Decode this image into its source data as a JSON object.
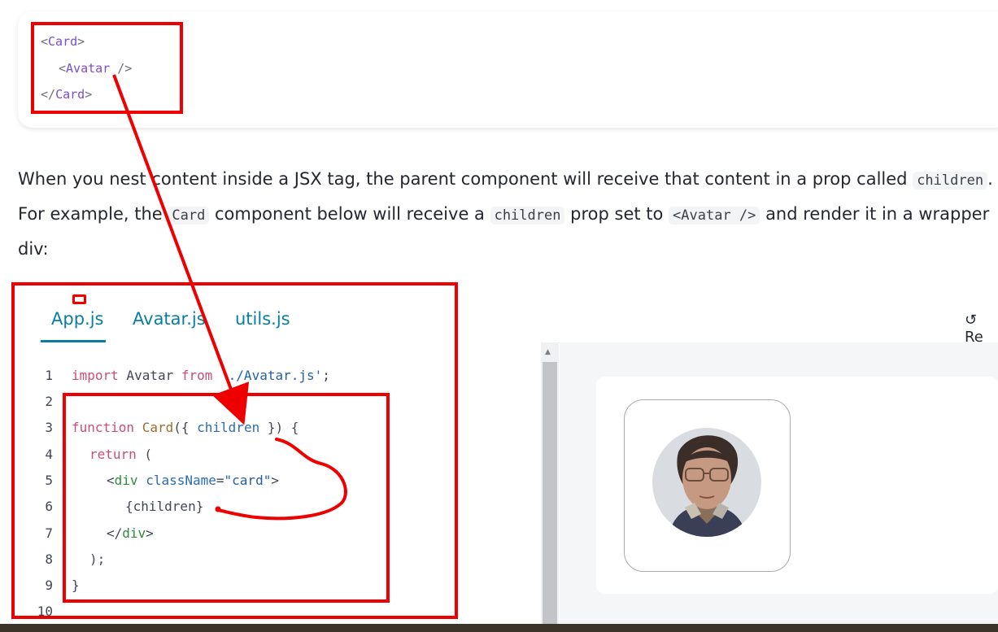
{
  "snippet": {
    "line1_open": "<",
    "line1_tag": "Card",
    "line1_close": ">",
    "line2_open": "<",
    "line2_tag": "Avatar",
    "line2_close": " />",
    "line3_open": "</",
    "line3_tag": "Card",
    "line3_close": ">"
  },
  "paragraph": {
    "t1": "When you nest content inside a JSX tag, the parent component will receive that content in a prop called ",
    "c1": "children",
    "t2": ". For example, the ",
    "c2": "Card",
    "t3": " component below will receive a ",
    "c3": "children",
    "t4": " prop set to ",
    "c4": "<Avatar />",
    "t5": " and render it in a wrapper div:"
  },
  "sandpack": {
    "tabs": [
      {
        "label": "App.js",
        "active": true
      },
      {
        "label": "Avatar.js",
        "active": false
      },
      {
        "label": "utils.js",
        "active": false
      }
    ],
    "reset_label": "Re",
    "reset_icon": "reset-icon",
    "line_numbers": [
      "1",
      "2",
      "3",
      "4",
      "5",
      "6",
      "7",
      "8",
      "9",
      "10"
    ],
    "code": {
      "l1": {
        "kw": "import",
        "t1": " Avatar ",
        "kw2": "from",
        "t2": " ",
        "str": "'./Avatar.js'",
        "t3": ";"
      },
      "l3": {
        "kw": "function",
        "t1": " ",
        "fn": "Card",
        "t2": "({ ",
        "pr": "children",
        "t3": " }) {"
      },
      "l4": {
        "kw": "return",
        "t1": " ("
      },
      "l5": {
        "t1": "<",
        "jt": "div",
        "t2": " ",
        "at": "className",
        "t3": "=",
        "str": "\"card\"",
        "t4": ">"
      },
      "l6": {
        "t1": "{children}"
      },
      "l7": {
        "t1": "</",
        "jt": "div",
        "t2": ">"
      },
      "l8": {
        "t1": ");"
      },
      "l9": {
        "t1": "}"
      }
    }
  },
  "preview": {
    "avatar_alt": "avatar photo of a person with glasses"
  },
  "colors": {
    "accent": "#087ea4",
    "annotation_red": "#ee0000",
    "keyword": "#c94d78",
    "tag_purple": "#7b4bd1"
  }
}
